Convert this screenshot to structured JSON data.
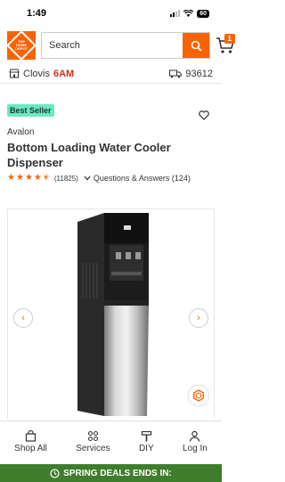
{
  "status": {
    "time": "1:49",
    "battery": "60"
  },
  "header": {
    "logo_text": "THE HOME DEPOT",
    "search_placeholder": "Search",
    "cart_count": "1"
  },
  "location": {
    "store_name": "Clovis",
    "store_hours": "6AM",
    "zip": "93612"
  },
  "product": {
    "badge": "Best Seller",
    "brand": "Avalon",
    "title": "Bottom Loading Water Cooler Dispenser",
    "rating_stars": 4.5,
    "review_count": "(11825)",
    "qa_label": "Questions & Answers (124)"
  },
  "bottom_nav": [
    {
      "label": "Shop All",
      "icon": "shopping-bag-icon"
    },
    {
      "label": "Services",
      "icon": "grid-icon"
    },
    {
      "label": "DIY",
      "icon": "hammer-icon"
    },
    {
      "label": "Log In",
      "icon": "user-icon"
    }
  ],
  "promo": {
    "text": "SPRING DEALS ENDS IN:"
  },
  "colors": {
    "brand_orange": "#f96302",
    "promo_green": "#3e7d2b",
    "badge_mint": "#6be8c0"
  }
}
